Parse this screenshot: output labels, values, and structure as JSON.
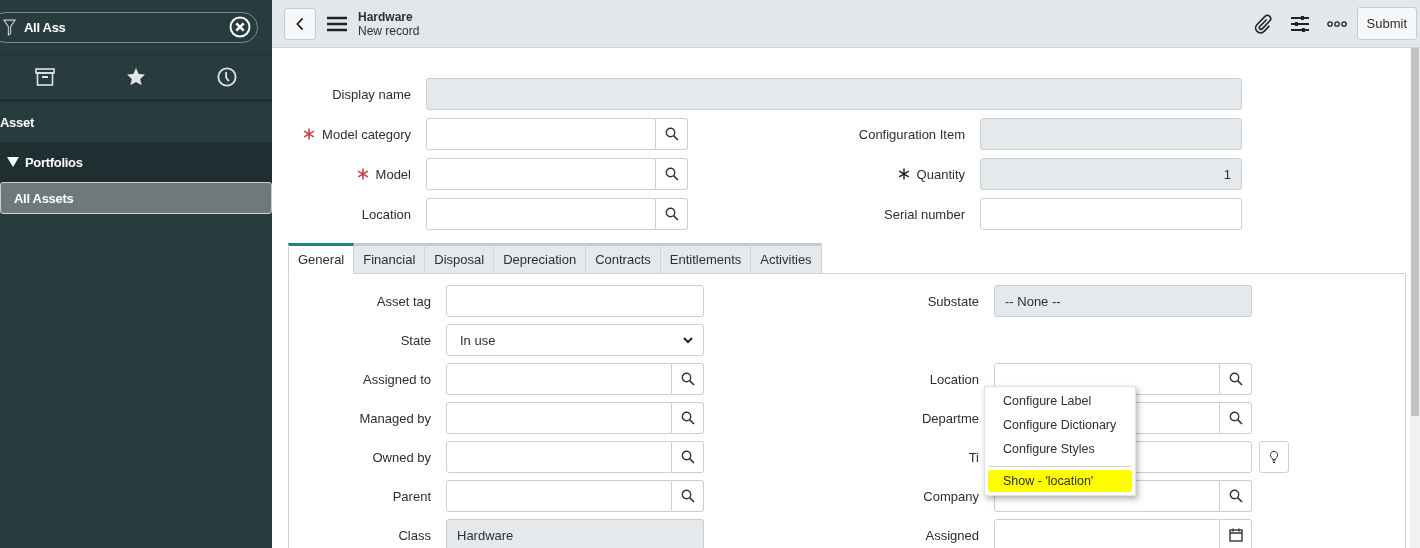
{
  "sidebar": {
    "filter": {
      "value": "All Ass"
    },
    "nav": [
      {
        "label": "Asset",
        "kind": "app",
        "selected": false
      },
      {
        "label": "Portfolios",
        "kind": "module",
        "expanded": true,
        "selected": false
      },
      {
        "label": "All Assets",
        "kind": "link",
        "selected": true
      }
    ]
  },
  "header": {
    "title": "Hardware",
    "subtitle": "New record",
    "submit": "Submit"
  },
  "record_fields": [
    {
      "left": {
        "label": "Display name",
        "kind": "readonly",
        "wide": true,
        "mandatory": false
      }
    },
    {
      "left": {
        "label": "Model category",
        "kind": "lookup",
        "mandatory": true,
        "filled": false
      },
      "right": {
        "label": "Configuration Item",
        "kind": "readonly",
        "mandatory": false
      }
    },
    {
      "left": {
        "label": "Model",
        "kind": "lookup",
        "mandatory": true,
        "filled": false
      },
      "right": {
        "label": "Quantity",
        "kind": "readonly",
        "value": "1",
        "mandatory": true,
        "filled": true
      }
    },
    {
      "left": {
        "label": "Location",
        "kind": "lookup",
        "mandatory": false
      },
      "right": {
        "label": "Serial number",
        "kind": "text",
        "mandatory": false
      }
    }
  ],
  "form_tabs": [
    {
      "label": "General",
      "selected": true
    },
    {
      "label": "Financial",
      "selected": false
    },
    {
      "label": "Disposal",
      "selected": false
    },
    {
      "label": "Depreciation",
      "selected": false
    },
    {
      "label": "Contracts",
      "selected": false
    },
    {
      "label": "Entitlements",
      "selected": false
    },
    {
      "label": "Activities",
      "selected": false
    }
  ],
  "tab_fields": [
    {
      "left": {
        "label": "Asset tag",
        "kind": "text",
        "mandatory": false
      },
      "right": {
        "label": "Substate",
        "kind": "readonly_select",
        "value": "-- None --",
        "mandatory": false
      }
    },
    {
      "left": {
        "label": "State",
        "kind": "select",
        "value": "In use",
        "mandatory": false
      }
    },
    {
      "left": {
        "label": "Assigned to",
        "kind": "lookup",
        "mandatory": false
      },
      "right": {
        "label": "Location",
        "kind": "lookup",
        "mandatory": false
      }
    },
    {
      "left": {
        "label": "Managed by",
        "kind": "lookup",
        "mandatory": false
      },
      "right": {
        "label": "Departme",
        "kind": "lookup",
        "mandatory": false
      }
    },
    {
      "left": {
        "label": "Owned by",
        "kind": "lookup",
        "mandatory": false
      },
      "right": {
        "label": "Ti",
        "kind": "text_suggest",
        "mandatory": false
      }
    },
    {
      "left": {
        "label": "Parent",
        "kind": "lookup",
        "mandatory": false
      },
      "right": {
        "label": "Company",
        "kind": "lookup",
        "mandatory": false
      }
    },
    {
      "left": {
        "label": "Class",
        "kind": "readonly",
        "value": "Hardware",
        "mandatory": false
      },
      "right": {
        "label": "Assigned",
        "kind": "date",
        "mandatory": false
      }
    }
  ],
  "context_menu": [
    {
      "kind": "item",
      "label": "Configure Label",
      "highlighted": false
    },
    {
      "kind": "item",
      "label": "Configure Dictionary",
      "highlighted": false
    },
    {
      "kind": "item",
      "label": "Configure Styles",
      "highlighted": false
    },
    {
      "kind": "separator"
    },
    {
      "kind": "item",
      "label": "Show - 'location'",
      "highlighted": true
    }
  ]
}
